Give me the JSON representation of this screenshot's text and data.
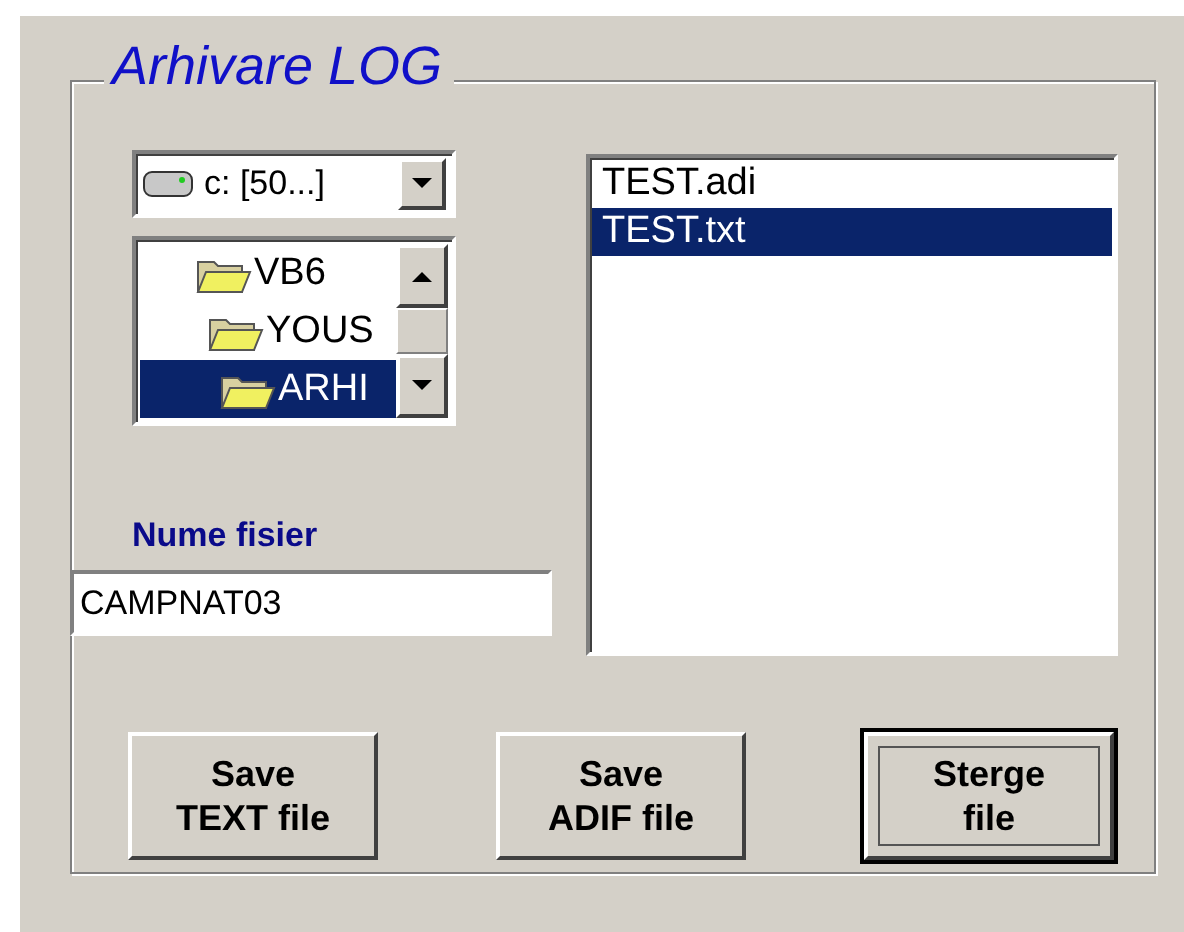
{
  "group": {
    "title": "Arhivare LOG"
  },
  "drive": {
    "value": "c: [50...]"
  },
  "folders": [
    {
      "name": "VB6",
      "selected": false,
      "children": [
        {
          "name": "YOUS",
          "selected": false,
          "children": [
            {
              "name": "ARHI",
              "selected": true
            }
          ]
        }
      ]
    }
  ],
  "files": [
    {
      "name": "TEST.adi",
      "selected": false
    },
    {
      "name": "TEST.txt",
      "selected": true
    }
  ],
  "filename": {
    "label": "Nume fisier",
    "value": "CAMPNAT03"
  },
  "buttons": [
    {
      "lines": [
        "Save",
        "TEXT file"
      ],
      "default": false
    },
    {
      "lines": [
        "Save",
        "ADIF file"
      ],
      "default": false
    },
    {
      "lines": [
        "Sterge",
        "file"
      ],
      "default": true
    }
  ]
}
